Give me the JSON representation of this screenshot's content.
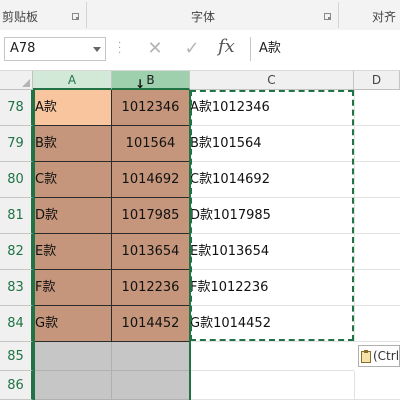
{
  "ribbon": {
    "groups": [
      "剪贴板",
      "字体",
      "对齐"
    ]
  },
  "formula_bar": {
    "name_box": "A78",
    "cancel_glyph": "✕",
    "enter_glyph": "✓",
    "fx_label": "fx",
    "formula": "A款"
  },
  "columns": [
    "A",
    "B",
    "C",
    "D"
  ],
  "rows": [
    {
      "num": "78",
      "a": "A款",
      "b": "1012346",
      "c": "A款1012346"
    },
    {
      "num": "79",
      "a": "B款",
      "b": "101564",
      "c": "B款101564"
    },
    {
      "num": "80",
      "a": "C款",
      "b": "1014692",
      "c": "C款1014692"
    },
    {
      "num": "81",
      "a": "D款",
      "b": "1017985",
      "c": "D款1017985"
    },
    {
      "num": "82",
      "a": "E款",
      "b": "1013654",
      "c": "E款1013654"
    },
    {
      "num": "83",
      "a": "F款",
      "b": "1012236",
      "c": "F款1012236"
    },
    {
      "num": "84",
      "a": "G款",
      "b": "1014452",
      "c": "G款1014452"
    }
  ],
  "empty_rows": [
    "85",
    "86"
  ],
  "paste_options": {
    "label": "(Ctrl)"
  },
  "colors": {
    "accent": "#217346",
    "selected_fill": "#c5967b",
    "active_fill": "#f8c59e",
    "empty_selected_fill": "#c6c6c6"
  }
}
